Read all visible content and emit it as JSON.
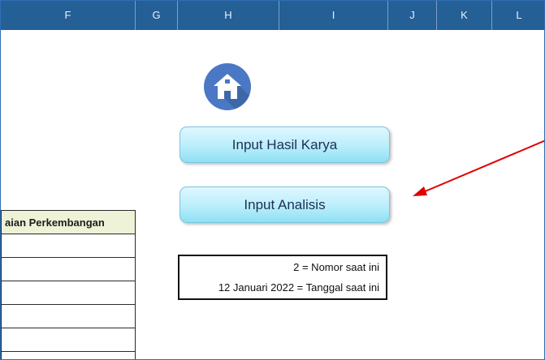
{
  "columns": [
    "F",
    "G",
    "H",
    "I",
    "J",
    "K",
    "L"
  ],
  "home_icon": {
    "name": "home-icon",
    "color": "#4a78c4"
  },
  "buttons": {
    "input_hasil_karya": "Input Hasil Karya",
    "input_analisis": "Input Analisis"
  },
  "table": {
    "header": "aian Perkembangan",
    "rows": [
      "",
      "",
      "",
      "",
      "",
      ""
    ]
  },
  "info": {
    "nomor_line": "2 = Nomor saat ini",
    "tanggal_line": "12 Januari 2022 = Tanggal saat ini"
  },
  "arrow_color": "#e00000"
}
